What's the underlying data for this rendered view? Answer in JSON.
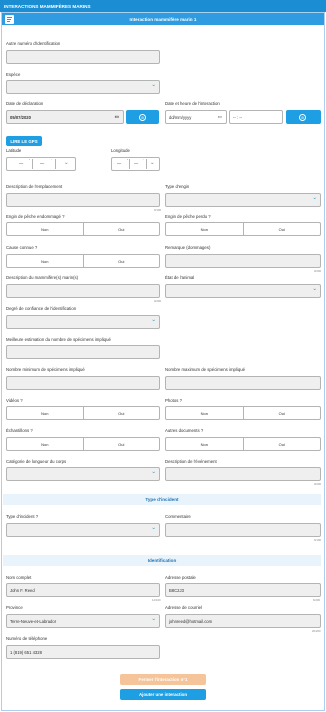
{
  "app_title": "INTERACTIONS MAMMIFÈRES MARINS",
  "panel_title": "Interaction mammifère marin 1",
  "labels": {
    "other_id": "Autre numéro d'identification",
    "species": "Espèce",
    "declaration_date": "Date de déclaration",
    "interaction_datetime": "Date et heure de l'interaction",
    "latitude": "Latitude",
    "longitude": "Longitude",
    "location_desc": "Description de l'emplacement",
    "gear_type": "Type d'engin",
    "fishing_gear_damaged": "Engin de pêche endommagé ?",
    "fishing_gear_lost": "Engin de pêche perdu ?",
    "cause_known": "Cause connue ?",
    "remarks": "Remarque (dommages)",
    "mammal_desc": "Description du mammifère(s) marin(s)",
    "animal_state": "État de l'animal",
    "confidence": "Degré de confiance de l'identification",
    "best_estimate": "Meilleure estimation du nombre de spécimens impliqué",
    "min_count": "Nombre minimum de spécimens impliqué",
    "max_count": "Nombre maximum de spécimens impliqué",
    "videos": "Vidéos ?",
    "photos": "Photos ?",
    "samples": "Échantillons ?",
    "other_docs": "Autres documents ?",
    "body_length": "Catégorie de longueur du corps",
    "event_desc": "Description de l'événement",
    "incident_type": "Type d'incident ?",
    "comment": "Commentaire",
    "full_name": "Nom complet",
    "postal_address": "Adresse postale",
    "province": "Province",
    "email": "Adresse de courriel",
    "phone": "Numéro de téléphone"
  },
  "sections": {
    "incident": "Type d'incident",
    "identification": "Identification"
  },
  "values": {
    "declaration_date": "05/07/2020",
    "interaction_date_placeholder": "dd/mm/yyyy",
    "interaction_time": "-- : --",
    "lat_deg": "—",
    "lat_min": "—",
    "lon_deg": "—",
    "lon_min": "—",
    "full_name": "John F. Reed",
    "postal_address": "B8C2J3",
    "province": "Terre-Neuve-et-Labrador",
    "email": "johnreed@hotmail.com",
    "phone": "1 (819) 651 4328"
  },
  "counters": {
    "location_desc": "0/100",
    "remarks": "0/200",
    "mammal_desc": "0/200",
    "event_desc": "0/200",
    "comment": "0/100",
    "full_name": "12/100",
    "postal_address": "6/200",
    "email": "20/200"
  },
  "choices": {
    "no": "Non",
    "yes": "Oui"
  },
  "units": {
    "deg": "°",
    "min": "'"
  },
  "buttons": {
    "gps": "LIRE LE GPS",
    "close": "Fermer l'interaction n°1",
    "add": "Ajouter une interaction"
  },
  "icons": {
    "header": "form-icon",
    "dropdown": "chevron-down-icon",
    "calendar": "calendar-icon",
    "clock": "clock-icon"
  },
  "colors": {
    "primary": "#1f9fe3",
    "header": "#1b8dd3",
    "disabled": "#f5c49a",
    "section_bg": "#e8f3fb"
  }
}
